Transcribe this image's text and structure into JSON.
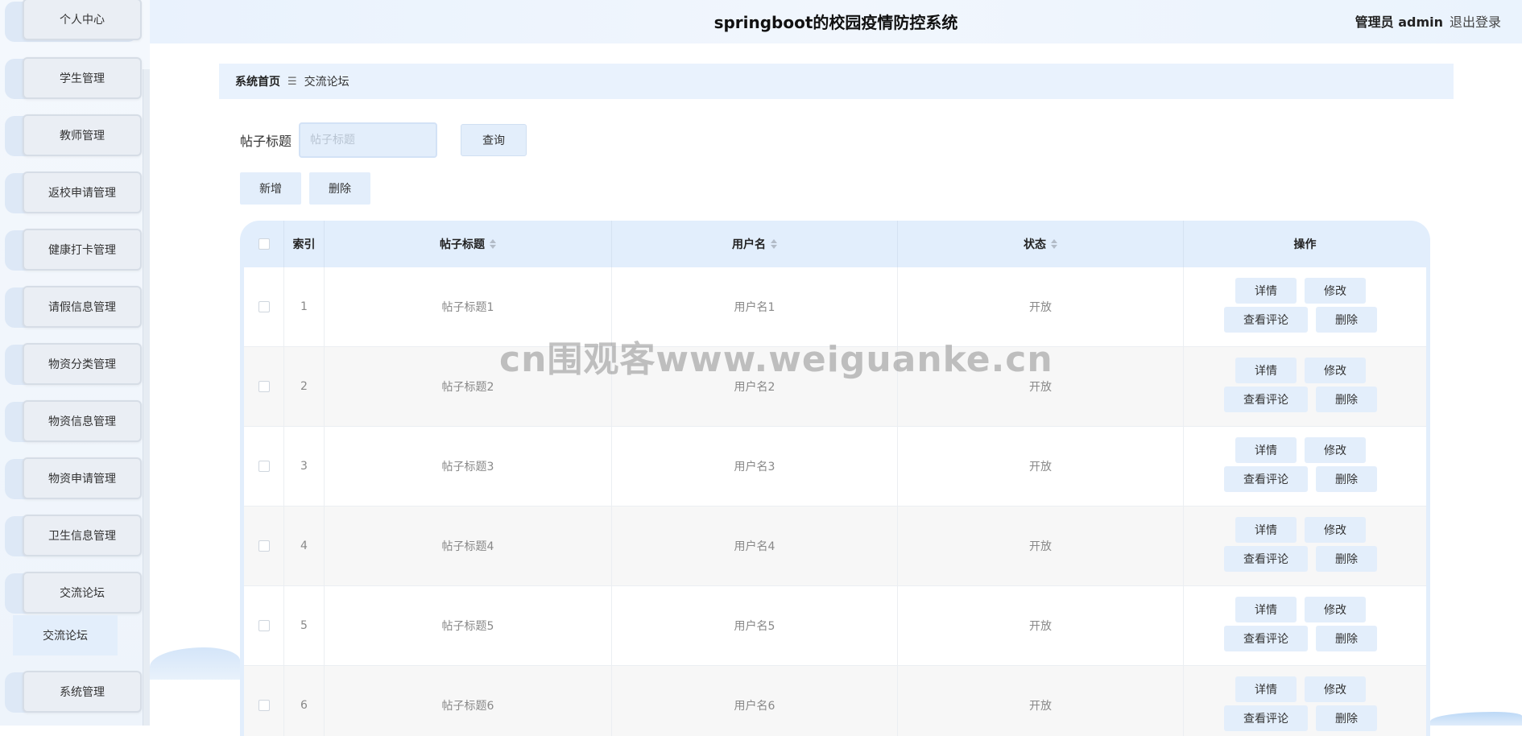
{
  "sidebar": {
    "items": [
      {
        "label": "个人中心"
      },
      {
        "label": "学生管理"
      },
      {
        "label": "教师管理"
      },
      {
        "label": "返校申请管理"
      },
      {
        "label": "健康打卡管理"
      },
      {
        "label": "请假信息管理"
      },
      {
        "label": "物资分类管理"
      },
      {
        "label": "物资信息管理"
      },
      {
        "label": "物资申请管理"
      },
      {
        "label": "卫生信息管理"
      },
      {
        "label": "交流论坛"
      },
      {
        "label": "系统管理"
      }
    ],
    "sub_item": "交流论坛"
  },
  "header": {
    "title": "springboot的校园疫情防控系统",
    "user": "管理员 admin",
    "logout": "退出登录"
  },
  "breadcrumb": {
    "home": "系统首页",
    "separator": "☰",
    "current": "交流论坛"
  },
  "search": {
    "label": "帖子标题",
    "placeholder": "帖子标题",
    "button": "查询"
  },
  "actions": {
    "add": "新增",
    "delete": "删除"
  },
  "table": {
    "headers": {
      "index": "索引",
      "title": "帖子标题",
      "username": "用户名",
      "status": "状态",
      "ops": "操作"
    },
    "row_buttons": {
      "detail": "详情",
      "edit": "修改",
      "comments": "查看评论",
      "delete": "删除"
    },
    "rows": [
      {
        "index": "1",
        "title": "帖子标题1",
        "username": "用户名1",
        "status": "开放"
      },
      {
        "index": "2",
        "title": "帖子标题2",
        "username": "用户名2",
        "status": "开放"
      },
      {
        "index": "3",
        "title": "帖子标题3",
        "username": "用户名3",
        "status": "开放"
      },
      {
        "index": "4",
        "title": "帖子标题4",
        "username": "用户名4",
        "status": "开放"
      },
      {
        "index": "5",
        "title": "帖子标题5",
        "username": "用户名5",
        "status": "开放"
      },
      {
        "index": "6",
        "title": "帖子标题6",
        "username": "用户名6",
        "status": "开放"
      }
    ]
  },
  "watermark": "cn围观客www.weiguanke.cn",
  "colors": {
    "accent_light": "#e3eefb",
    "header_bg": "#e9f2fd",
    "sidebar_bg": "#f4f8fd"
  }
}
